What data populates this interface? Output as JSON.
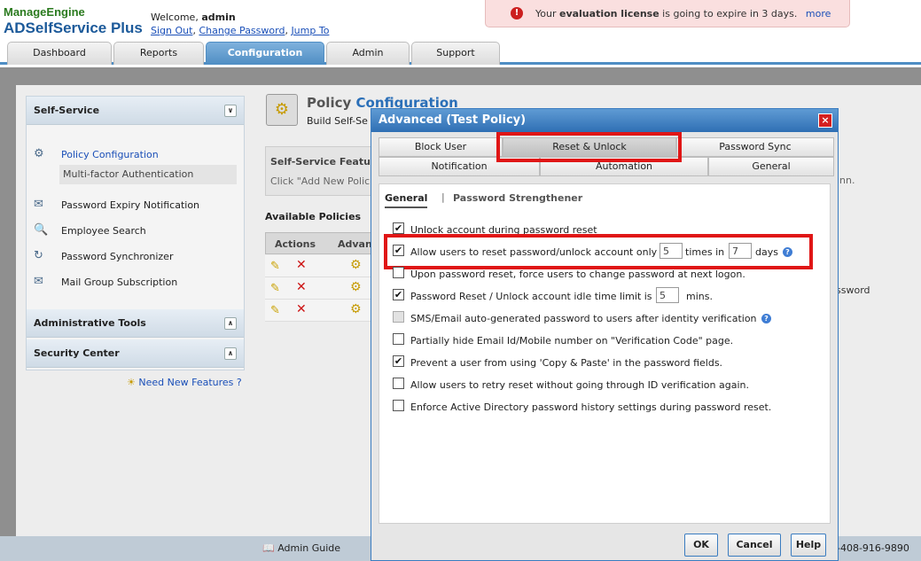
{
  "header": {
    "logo_line1": "ManageEngine",
    "logo_line2": "ADSelfService Plus",
    "welcome_prefix": "Welcome,",
    "user": "admin",
    "links": [
      "Sign Out",
      "Change Password",
      "Jump To"
    ],
    "link_sep": ","
  },
  "notice": {
    "prefix": "Your",
    "bold": "evaluation license",
    "suffix": "is going to expire in 3 days.",
    "more": "more",
    "icon": "exclamation-icon",
    "color": "#cc1f1f"
  },
  "main_tabs": [
    "Dashboard",
    "Reports",
    "Configuration",
    "Admin",
    "Support"
  ],
  "active_tab": "Configuration",
  "sidebar": {
    "self_service": "Self-Service",
    "items": [
      "Policy Configuration",
      "Multi-factor Authentication",
      "Password Expiry Notification",
      "Employee Search",
      "Password Synchronizer",
      "Mail Group Subscription"
    ],
    "admin_tools": "Administrative Tools",
    "security_center": "Security Center",
    "need_features": "Need New Features ?"
  },
  "page": {
    "title_a": "Policy",
    "title_b": "Configuration",
    "subtitle": "Build Self-Se",
    "ssf_title": "Self-Service Featu",
    "ssf_text": "Click \"Add New Polic",
    "ssf_right": "nn.",
    "available": "Available Policies",
    "col_actions": "Actions",
    "col_adv": "Advan",
    "row_right": "ssword"
  },
  "dialog": {
    "title": "Advanced (Test Policy)",
    "tabs_row1": [
      "Block User",
      "Reset & Unlock",
      "Password Sync"
    ],
    "tabs_row2": [
      "Notification",
      "Automation",
      "General"
    ],
    "active_tab": "Reset & Unlock",
    "subtabs": [
      "General",
      "Password Strengthener"
    ],
    "subtab_sep": "|",
    "options": {
      "o1": {
        "label": "Unlock account during password reset",
        "checked": true
      },
      "o2": {
        "pre": "Allow users to reset password/unlock account only",
        "n1": "5",
        "mid": "times in",
        "n2": "7",
        "post": "days",
        "checked": true
      },
      "o3": {
        "label": "Upon password reset, force users to change password at next logon.",
        "checked": false
      },
      "o4": {
        "pre": "Password Reset / Unlock account idle time limit is",
        "n": "5",
        "post": "mins.",
        "checked": true
      },
      "o5": {
        "label": "SMS/Email auto-generated password to users after identity verification",
        "checked": false,
        "disabled": true
      },
      "o6": {
        "label": "Partially hide Email Id/Mobile number on \"Verification Code\" page.",
        "checked": false
      },
      "o7": {
        "label": "Prevent a user from using 'Copy & Paste' in the password fields.",
        "checked": true
      },
      "o8": {
        "label": "Allow users to retry reset without going through ID verification again.",
        "checked": false
      },
      "o9": {
        "label": "Enforce Active Directory password history settings during password reset.",
        "checked": false
      }
    },
    "buttons": {
      "ok": "OK",
      "cancel": "Cancel",
      "help": "Help"
    },
    "check_glyph": "✔",
    "help_glyph": "?",
    "close_glyph": "×"
  },
  "footer": {
    "admin_guide": "Admin Guide",
    "phone": "-408-916-9890"
  },
  "colors": {
    "accent": "#2f6fb4",
    "highlight": "#e01616"
  }
}
